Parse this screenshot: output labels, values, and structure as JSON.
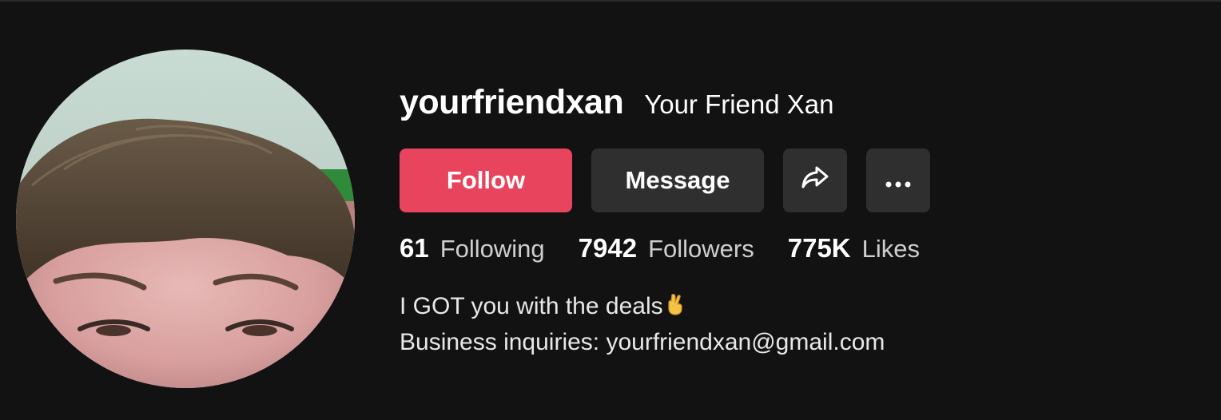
{
  "profile": {
    "username": "yourfriendxan",
    "display_name": "Your Friend Xan",
    "avatar_alt": "profile photo"
  },
  "actions": {
    "follow_label": "Follow",
    "message_label": "Message",
    "share_icon": "share-arrow-icon",
    "more_icon": "more-dots-icon"
  },
  "stats": {
    "following_count": "61",
    "following_label": "Following",
    "followers_count": "7942",
    "followers_label": "Followers",
    "likes_count": "775K",
    "likes_label": "Likes"
  },
  "bio": {
    "line1": "I GOT you with the deals",
    "line1_emoji": "crossed-fingers-emoji",
    "line2": "Business inquiries: yourfriendxan@gmail.com"
  },
  "colors": {
    "background": "#121212",
    "follow_button": "#e8445d",
    "secondary_button": "#2f2f2f"
  }
}
